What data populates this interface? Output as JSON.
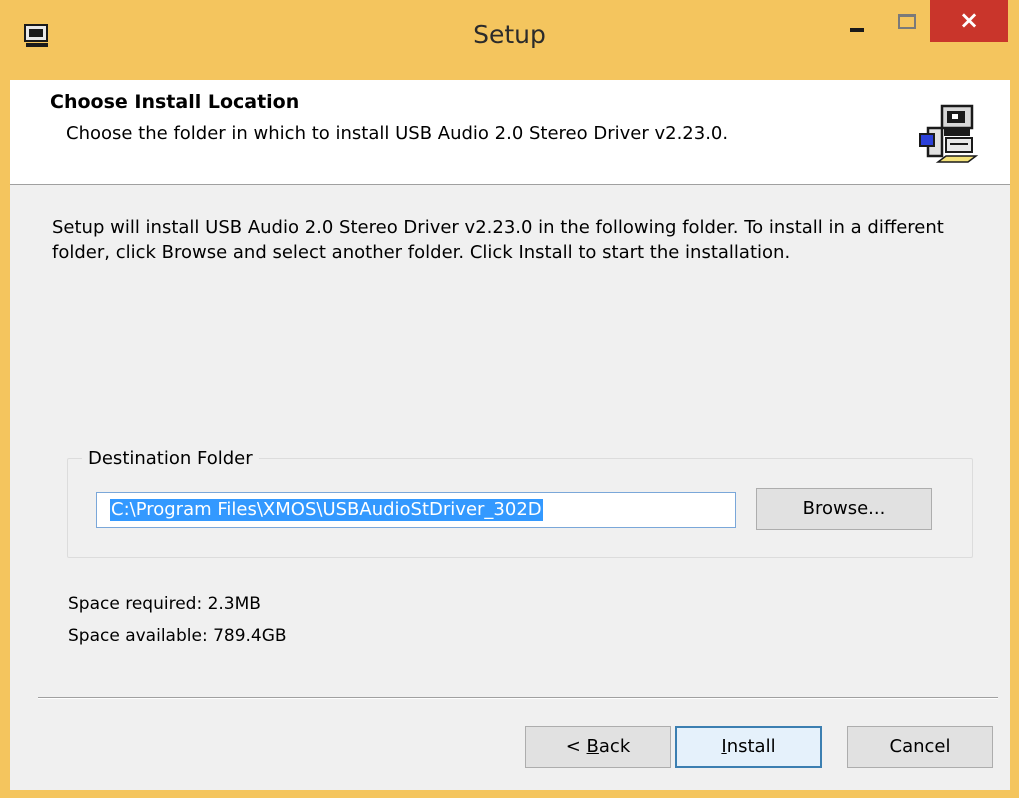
{
  "window": {
    "title": "Setup",
    "close_glyph": "×"
  },
  "header": {
    "title": "Choose Install Location",
    "subtitle": "Choose the folder in which to install USB Audio 2.0 Stereo Driver v2.23.0.",
    "icon": "installer-computer-icon"
  },
  "body": {
    "description": "Setup will install USB Audio 2.0 Stereo Driver v2.23.0 in the following folder. To install in a different folder, click Browse and select another folder. Click Install to start the installation."
  },
  "destination": {
    "group_label": "Destination Folder",
    "path_value": "C:\\Program Files\\XMOS\\USBAudioStDriver_302D",
    "browse_label": "Browse..."
  },
  "space": {
    "required": "Space required: 2.3MB",
    "available": "Space available: 789.4GB"
  },
  "buttons": {
    "back_prefix": "< ",
    "back_accel": "B",
    "back_rest": "ack",
    "install_accel": "I",
    "install_rest": "nstall",
    "cancel": "Cancel"
  },
  "colors": {
    "title_bar": "#f4c55e",
    "close_button": "#c9352b",
    "selection": "#3399ff"
  }
}
